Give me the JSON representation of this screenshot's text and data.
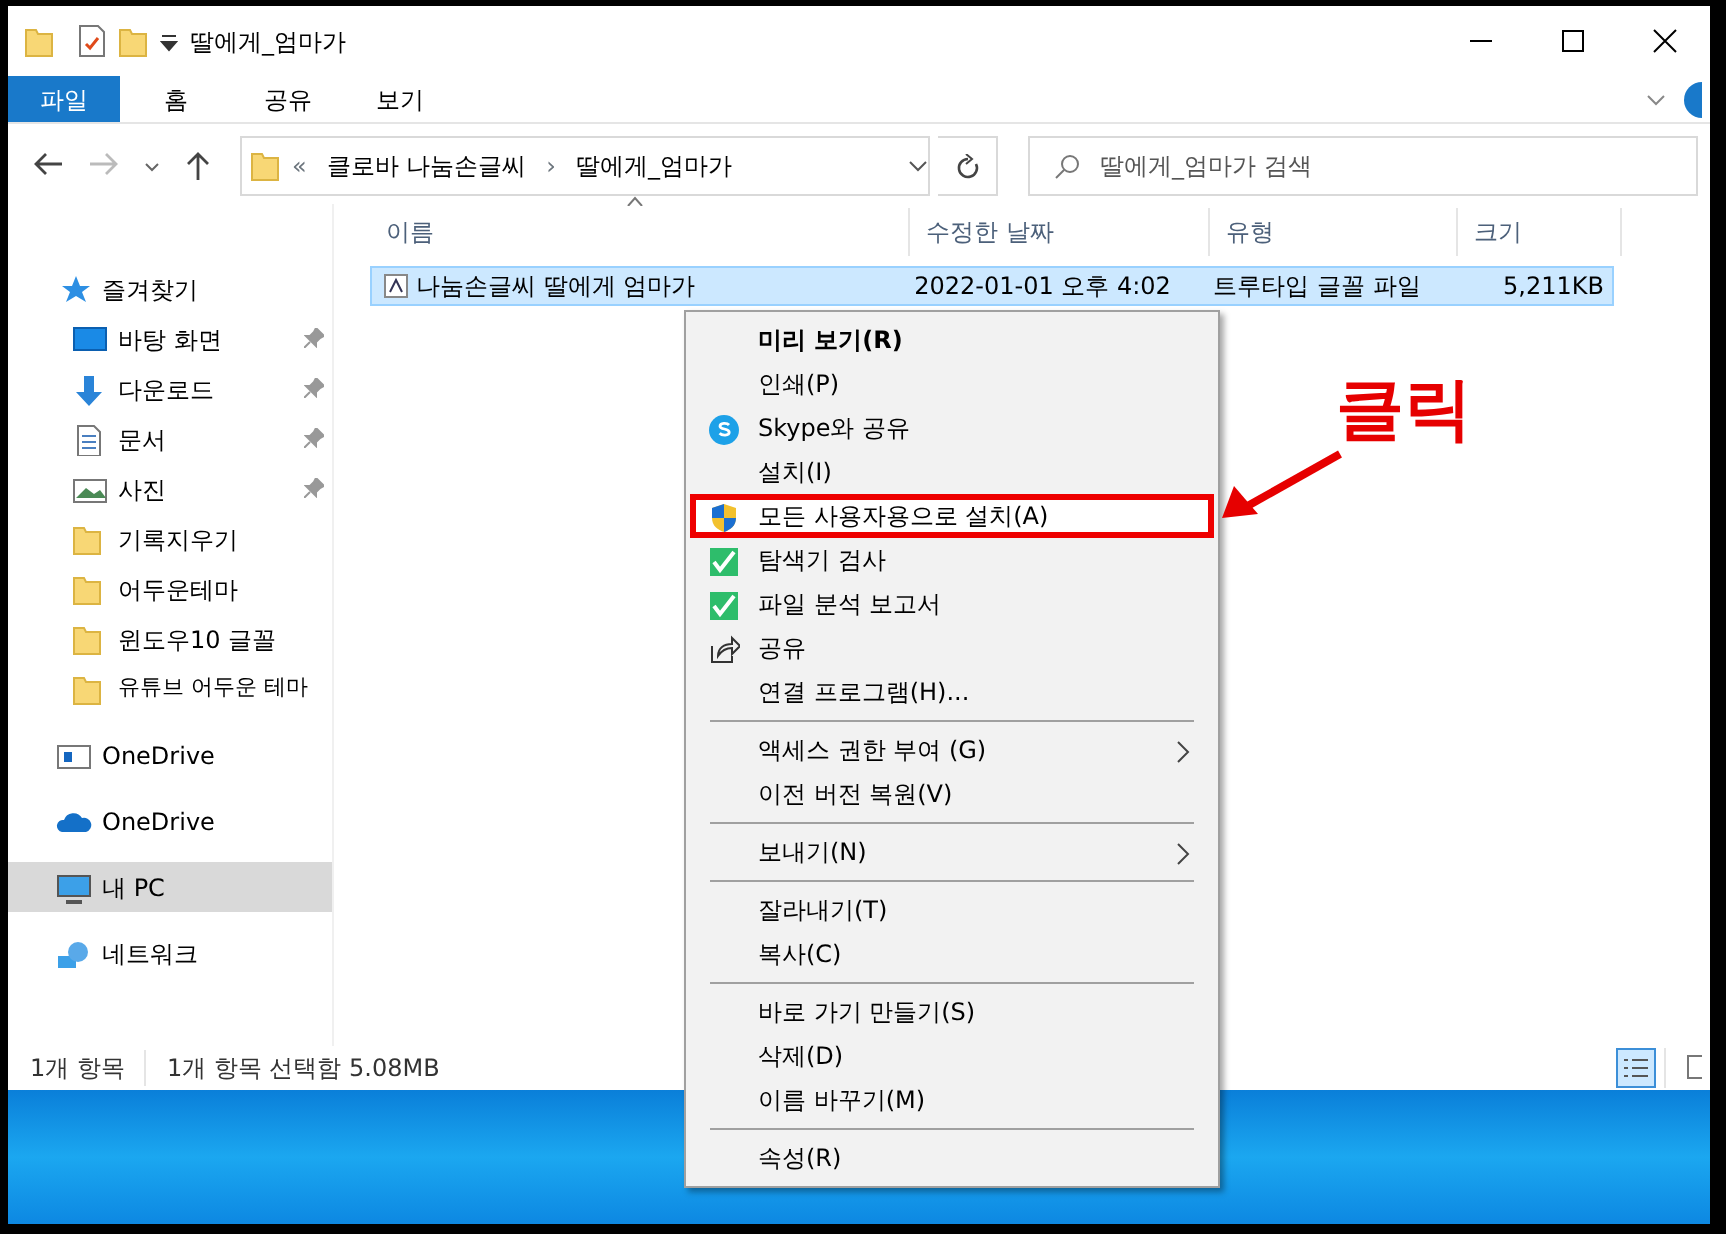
{
  "window": {
    "title": "딸에게_엄마가"
  },
  "ribbon": {
    "tabs": [
      {
        "label": "파일",
        "selected": true
      },
      {
        "label": "홈",
        "selected": false
      },
      {
        "label": "공유",
        "selected": false
      },
      {
        "label": "보기",
        "selected": false
      }
    ]
  },
  "address": {
    "overflow": "«",
    "path": [
      "클로바 나눔손글씨",
      "딸에게_엄마가"
    ],
    "separator": "›"
  },
  "search": {
    "placeholder": "딸에게_엄마가 검색"
  },
  "sidebar": {
    "items": [
      {
        "label": "즐겨찾기",
        "kind": "star",
        "pinned": false,
        "selected": false
      },
      {
        "label": "바탕 화면",
        "kind": "desktop",
        "pinned": true,
        "selected": false
      },
      {
        "label": "다운로드",
        "kind": "download",
        "pinned": true,
        "selected": false
      },
      {
        "label": "문서",
        "kind": "document",
        "pinned": true,
        "selected": false
      },
      {
        "label": "사진",
        "kind": "photo",
        "pinned": true,
        "selected": false
      },
      {
        "label": "기록지우기",
        "kind": "folder",
        "pinned": false,
        "selected": false
      },
      {
        "label": "어두운테마",
        "kind": "folder",
        "pinned": false,
        "selected": false
      },
      {
        "label": "윈도우10 글꼴",
        "kind": "folder",
        "pinned": false,
        "selected": false
      },
      {
        "label": "유튜브 어두운 테마",
        "kind": "folder",
        "pinned": false,
        "selected": false
      },
      {
        "label": "OneDrive",
        "kind": "drive",
        "pinned": false,
        "selected": false
      },
      {
        "label": "OneDrive",
        "kind": "cloud",
        "pinned": false,
        "selected": false
      },
      {
        "label": "내 PC",
        "kind": "pc",
        "pinned": false,
        "selected": true
      },
      {
        "label": "네트워크",
        "kind": "network",
        "pinned": false,
        "selected": false
      }
    ]
  },
  "table": {
    "columns": [
      "이름",
      "수정한 날짜",
      "유형",
      "크기"
    ],
    "rows": [
      {
        "cells": [
          "나눔손글씨 딸에게 엄마가",
          "2022-01-01 오후 4:02",
          "트루타입 글꼴 파일",
          "5,211KB"
        ],
        "selected": true
      }
    ]
  },
  "status_bar": [
    "1개 항목",
    "1개 항목 선택함 5.08MB"
  ],
  "context_menu": {
    "items": [
      {
        "kind": "plain",
        "label": "미리 보기(R)",
        "bold": true,
        "submenu": false,
        "selected": false
      },
      {
        "kind": "plain",
        "label": "인쇄(P)",
        "bold": false,
        "submenu": false,
        "selected": false
      },
      {
        "kind": "skype",
        "label": "Skype와 공유",
        "bold": false,
        "submenu": false,
        "selected": false
      },
      {
        "kind": "plain",
        "label": "설치(I)",
        "bold": false,
        "submenu": false,
        "selected": false
      },
      {
        "kind": "shield",
        "label": "모든 사용자용으로 설치(A)",
        "bold": false,
        "submenu": false,
        "selected": true
      },
      {
        "kind": "scan",
        "label": "탐색기 검사",
        "bold": false,
        "submenu": false,
        "selected": false
      },
      {
        "kind": "scan",
        "label": "파일 분석 보고서",
        "bold": false,
        "submenu": false,
        "selected": false
      },
      {
        "kind": "share",
        "label": "공유",
        "bold": false,
        "submenu": false,
        "selected": false
      },
      {
        "kind": "plain",
        "label": "연결 프로그램(H)...",
        "bold": false,
        "submenu": false,
        "selected": false
      },
      {
        "kind": "separator"
      },
      {
        "kind": "plain",
        "label": "액세스 권한 부여 (G)",
        "bold": false,
        "submenu": true,
        "selected": false
      },
      {
        "kind": "plain",
        "label": "이전 버전 복원(V)",
        "bold": false,
        "submenu": false,
        "selected": false
      },
      {
        "kind": "separator"
      },
      {
        "kind": "plain",
        "label": "보내기(N)",
        "bold": false,
        "submenu": true,
        "selected": false
      },
      {
        "kind": "separator"
      },
      {
        "kind": "plain",
        "label": "잘라내기(T)",
        "bold": false,
        "submenu": false,
        "selected": false
      },
      {
        "kind": "plain",
        "label": "복사(C)",
        "bold": false,
        "submenu": false,
        "selected": false
      },
      {
        "kind": "separator"
      },
      {
        "kind": "plain",
        "label": "바로 가기 만들기(S)",
        "bold": false,
        "submenu": false,
        "selected": false
      },
      {
        "kind": "plain",
        "label": "삭제(D)",
        "bold": false,
        "submenu": false,
        "selected": false
      },
      {
        "kind": "plain",
        "label": "이름 바꾸기(M)",
        "bold": false,
        "submenu": false,
        "selected": false
      },
      {
        "kind": "separator"
      },
      {
        "kind": "plain",
        "label": "속성(R)",
        "bold": false,
        "submenu": false,
        "selected": false
      }
    ]
  },
  "annotation": {
    "label": "클릭"
  }
}
